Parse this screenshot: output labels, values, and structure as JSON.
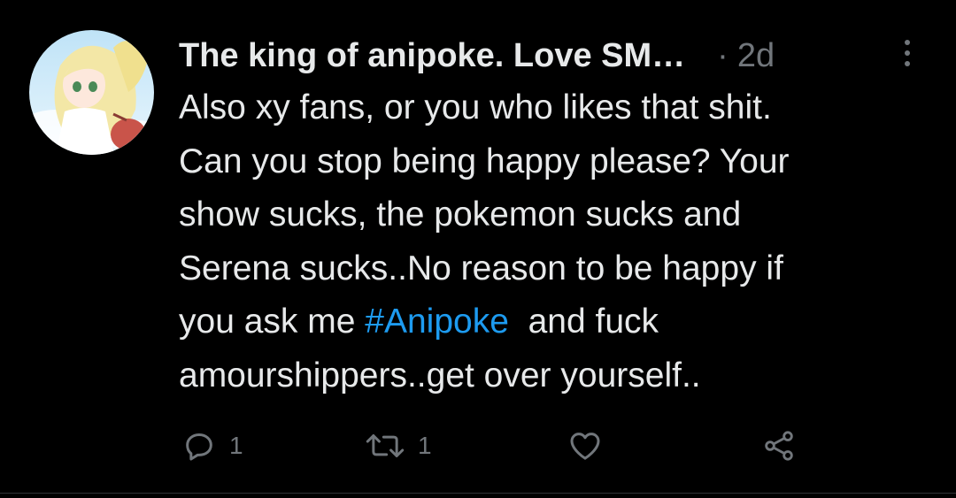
{
  "tweet": {
    "display_name": "The king of anipoke. Love SM…",
    "separator": "·",
    "timestamp": "2d",
    "text_lines": [
      "Also xy fans, or you who likes that shit.",
      "Can you stop being happy please? Your",
      "show sucks, the pokemon sucks and",
      "Serena sucks..No reason to be happy if"
    ],
    "text_line5_before": "you ask me ",
    "hashtag": "#Anipoke",
    "text_line5_after": "  and fuck",
    "text_line6": "amourshippers..get over yourself..",
    "actions": {
      "reply_count": "1",
      "retweet_count": "1"
    }
  },
  "icons": {
    "more": "more-vertical-icon",
    "reply": "reply-icon",
    "retweet": "retweet-icon",
    "like": "heart-icon",
    "share": "share-icon",
    "avatar": "avatar-anime-character"
  },
  "colors": {
    "background": "#000000",
    "text": "#e7e9ea",
    "muted": "#71767b",
    "link": "#1d9bf0"
  }
}
